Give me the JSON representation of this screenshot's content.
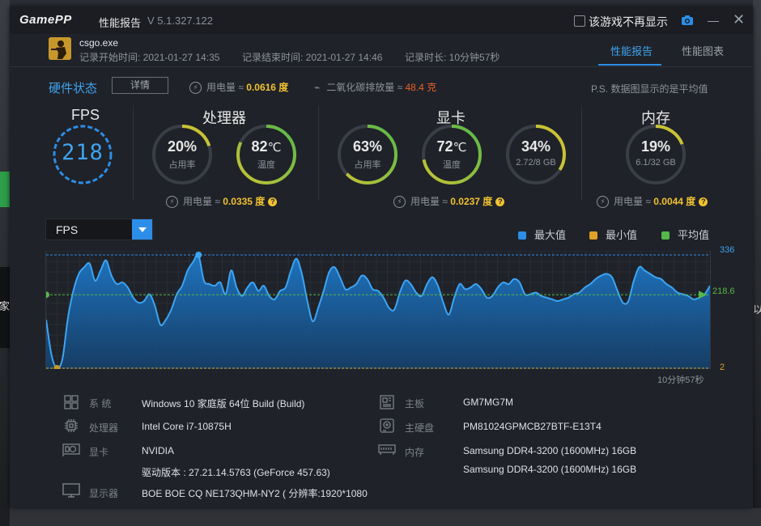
{
  "app": {
    "logo": "GamePP",
    "title": "性能报告",
    "version": "V 5.1.327.122",
    "dont_show_label": "该游戏不再显示",
    "colors": {
      "accent": "#2c8ee8",
      "highlight": "#f1c232",
      "good": "#55b84a",
      "co2": "#e8622a"
    }
  },
  "game": {
    "exe": "csgo.exe",
    "start_label": "记录开始时间: 2021-01-27 14:35",
    "end_label": "记录结束时间: 2021-01-27 14:46",
    "duration_label": "记录时长: 10分钟57秒"
  },
  "tabs": [
    {
      "label": "性能报告",
      "active": true
    },
    {
      "label": "性能图表",
      "active": false
    }
  ],
  "hardware": {
    "title": "硬件状态",
    "detail_btn": "详情",
    "power_label": "用电量 ≈ ",
    "power_value": "0.0616 度",
    "co2_label": "二氧化碳排放量 ≈ ",
    "co2_value": "48.4 克",
    "ps_note": "P.S. 数据图显示的是平均值"
  },
  "fps": {
    "title": "FPS",
    "value": "218"
  },
  "cpu": {
    "title": "处理器",
    "usage": {
      "value": "20%",
      "label": "占用率",
      "fraction": 0.2
    },
    "temp": {
      "value": "82",
      "unit": "℃",
      "label": "温度",
      "fraction": 0.82
    },
    "power_label": "用电量 ≈ ",
    "power_value": "0.0335 度"
  },
  "gpu": {
    "title": "显卡",
    "usage": {
      "value": "63%",
      "label": "占用率",
      "fraction": 0.63
    },
    "temp": {
      "value": "72",
      "unit": "℃",
      "label": "温度",
      "fraction": 0.72
    },
    "vram": {
      "value": "34%",
      "label": "2.72/8 GB",
      "fraction": 0.34
    },
    "power_label": "用电量 ≈ ",
    "power_value": "0.0237 度"
  },
  "memory": {
    "title": "内存",
    "usage": {
      "value": "19%",
      "label": "6.1/32 GB",
      "fraction": 0.19
    },
    "power_label": "用电量 ≈ ",
    "power_value": "0.0044 度"
  },
  "chart_select": "FPS",
  "legend": [
    {
      "label": "最大值",
      "color": "#2c8ee8"
    },
    {
      "label": "最小值",
      "color": "#e0a126"
    },
    {
      "label": "平均值",
      "color": "#55b84a"
    }
  ],
  "chart_data": {
    "type": "area",
    "series": [
      {
        "name": "FPS",
        "values": [
          145,
          40,
          2,
          30,
          150,
          230,
          280,
          300,
          310,
          260,
          290,
          320,
          275,
          250,
          255,
          240,
          210,
          195,
          200,
          220,
          185,
          130,
          145,
          175,
          220,
          245,
          290,
          315,
          335,
          260,
          250,
          245,
          255,
          220,
          290,
          240,
          215,
          240,
          255,
          230,
          245,
          215,
          205,
          230,
          240,
          290,
          325,
          280,
          200,
          140,
          180,
          230,
          285,
          300,
          270,
          235,
          240,
          250,
          275,
          265,
          235,
          230,
          210,
          180,
          175,
          225,
          260,
          250,
          225,
          215,
          250,
          270,
          245,
          195,
          160,
          210,
          250,
          235,
          240,
          250,
          235,
          210,
          215,
          240,
          255,
          250,
          265,
          255,
          220,
          220,
          225,
          215,
          210,
          205,
          200,
          205,
          210,
          220,
          225,
          240,
          250,
          265,
          275,
          280,
          270,
          230,
          195,
          200,
          260,
          300,
          290,
          280,
          270,
          265,
          250,
          240,
          225,
          220,
          215,
          205,
          210,
          220,
          245
        ]
      }
    ],
    "ymax_label": "336",
    "yavg_label": "218.6",
    "ymin_label": "2",
    "x_end_label": "10分钟57秒",
    "ylim": [
      2,
      336
    ],
    "max": 336,
    "avg": 218.6,
    "min": 2
  },
  "system_info": {
    "os": {
      "key": "系 统",
      "value": "Windows 10 家庭版 64位   Build (Build)"
    },
    "cpu": {
      "key": "处理器",
      "value": "Intel Core i7-10875H"
    },
    "gpu": {
      "key": "显卡",
      "value": "NVIDIA"
    },
    "driver": {
      "value": "驱动版本 : 27.21.14.5763 (GeForce 457.63)"
    },
    "display": {
      "key": "显示器",
      "value": "BOE BOE CQ NE173QHM-NY2 ( 分辨率:1920*1080"
    },
    "board": {
      "key": "主板",
      "value": "GM7MG7M"
    },
    "disk": {
      "key": "主硬盘",
      "value": "PM81024GPMCB27BTF-E13T4"
    },
    "mem": {
      "key": "内存",
      "value": "Samsung DDR4-3200 (1600MHz) 16GB",
      "value2": "Samsung DDR4-3200 (1600MHz) 16GB"
    }
  },
  "background": {
    "left_text": "家",
    "right_text": "以"
  }
}
